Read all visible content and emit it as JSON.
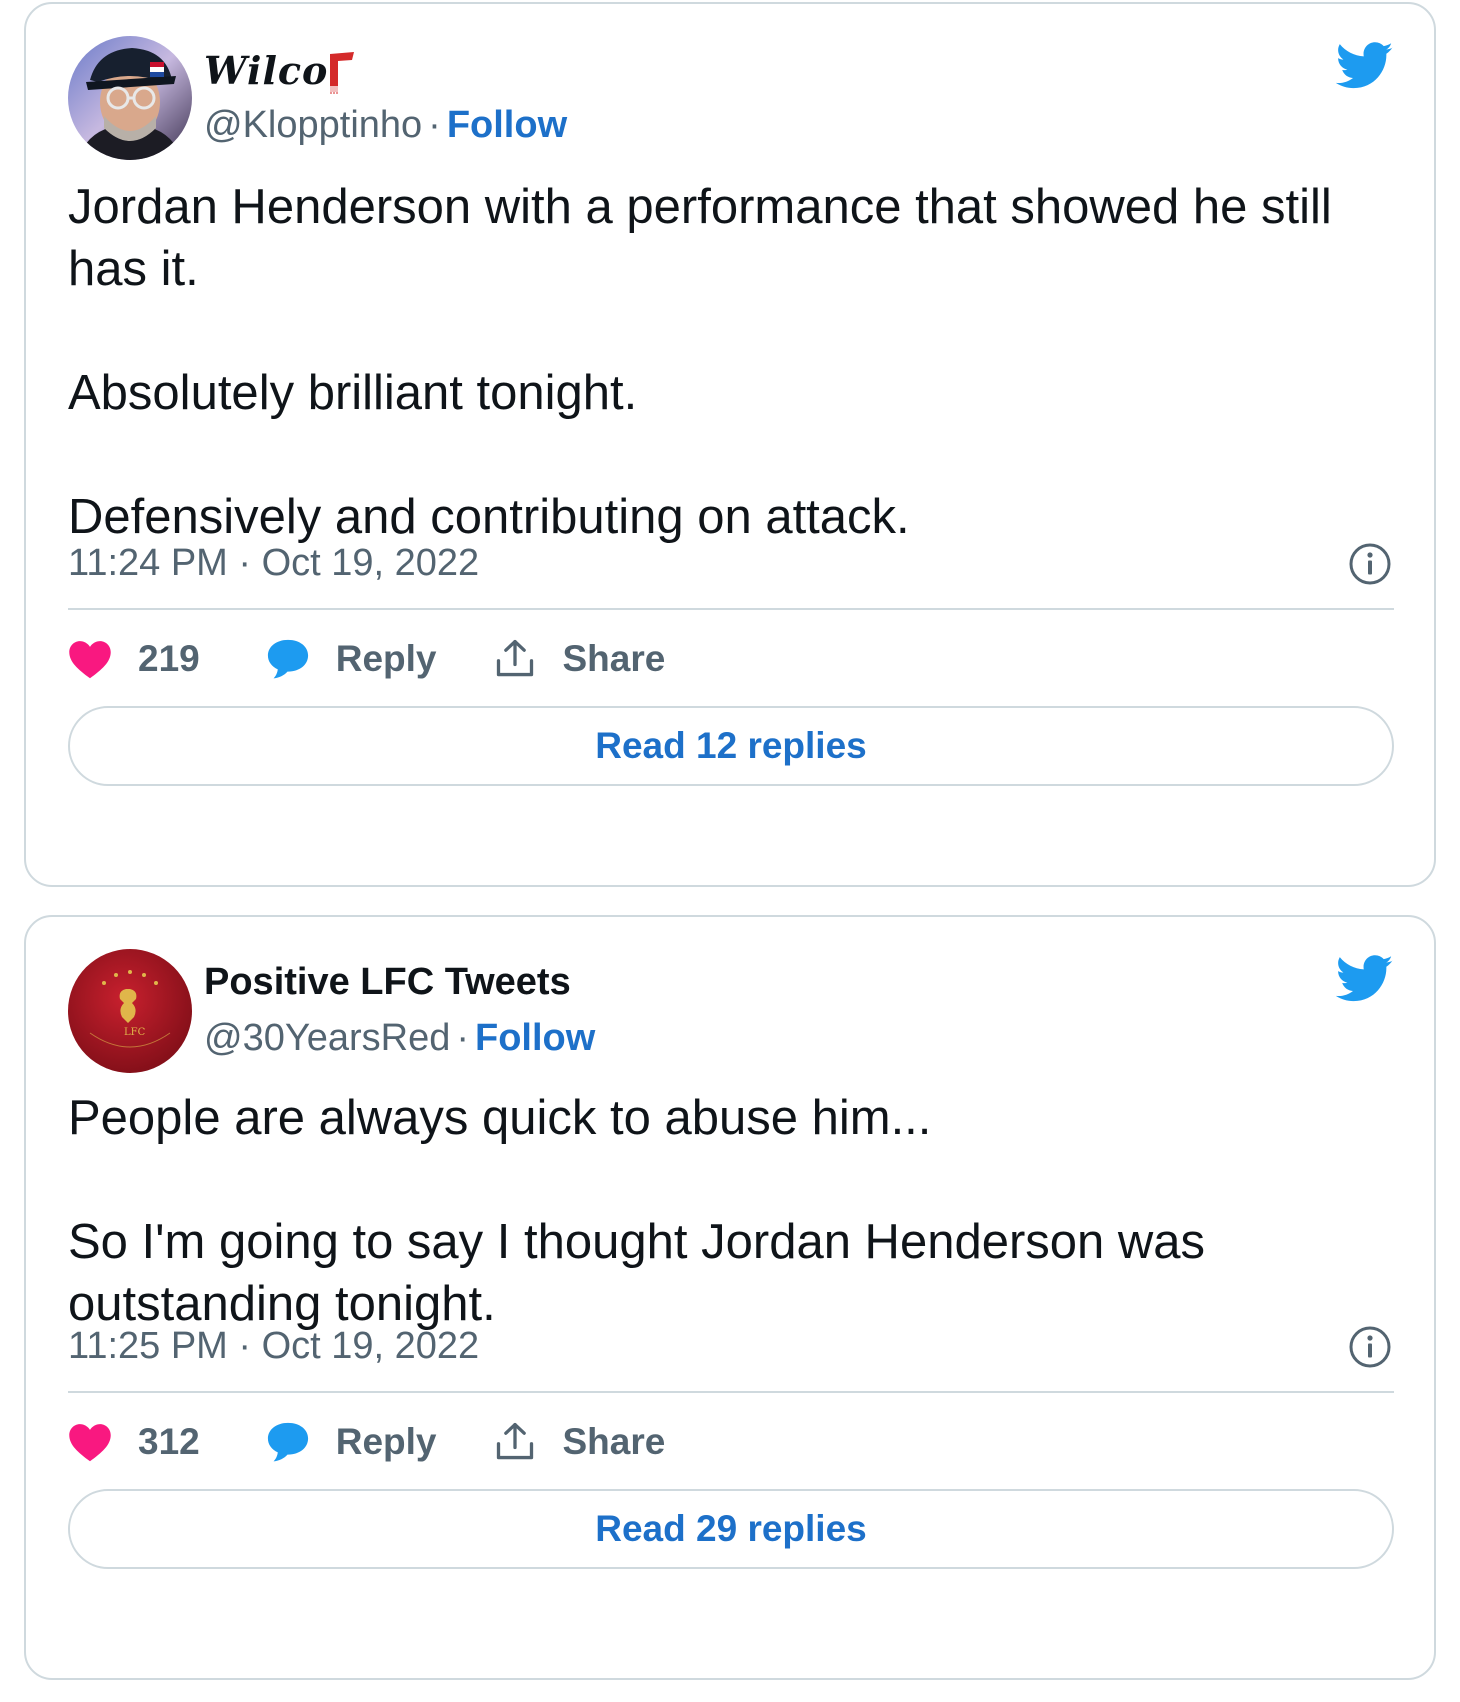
{
  "tweets": [
    {
      "author": {
        "display_name": "Wilco",
        "badge_icon": "red-scarf-icon",
        "handle": "@Klopptinho",
        "separator": "·",
        "follow_label": "Follow"
      },
      "text": [
        "Jordan Henderson with a performance that showed he still has it.",
        "Absolutely brilliant tonight.",
        "Defensively and contributing on attack."
      ],
      "timestamp": "11:24 PM · Oct 19, 2022",
      "likes": "219",
      "reply_label": "Reply",
      "share_label": "Share",
      "read_replies_label": "Read 12 replies"
    },
    {
      "author": {
        "display_name": "Positive LFC Tweets",
        "handle": "@30YearsRed",
        "separator": "·",
        "follow_label": "Follow"
      },
      "text": [
        "People are always quick to abuse him...",
        "So I'm going to say I thought Jordan Henderson was outstanding tonight."
      ],
      "timestamp": "11:25 PM · Oct 19, 2022",
      "likes": "312",
      "reply_label": "Reply",
      "share_label": "Share",
      "read_replies_label": "Read 29 replies"
    }
  ],
  "colors": {
    "twitter_blue": "#1d9bf0",
    "link_blue": "#1d70c9",
    "heart_pink": "#f91880",
    "border": "#cfd9de",
    "muted_text": "#536471"
  }
}
